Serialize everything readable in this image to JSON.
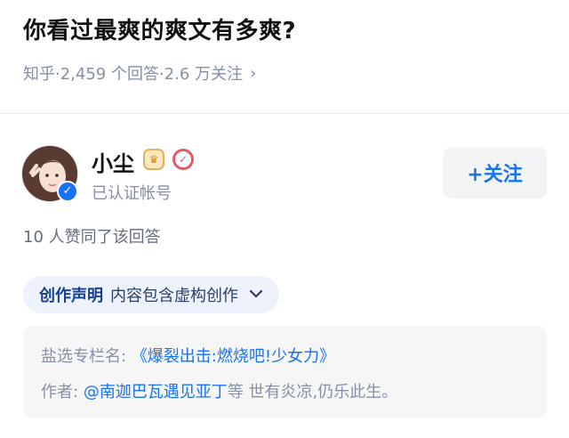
{
  "question": {
    "title": "你看过最爽的爽文有多爽?",
    "meta": "知乎·2,459 个回答·2.6 万关注"
  },
  "author": {
    "name": "小尘",
    "subtitle": "已认证帐号",
    "follow_label": "+关注"
  },
  "answer": {
    "vote_text": "10 人赞同了该回答"
  },
  "declaration": {
    "label": "创作声明",
    "value": "内容包含虚构创作"
  },
  "info": {
    "column_prefix": "盐选专栏名:",
    "column_name": "《爆裂出击:燃烧吧!少女力》",
    "author_prefix": "作者:",
    "author_name": "@南迦巴瓦遇见亚丁",
    "author_suffix": "等 世有炎凉,仍乐此生。"
  },
  "colors": {
    "accent": "#1772f6",
    "meta_gray": "#8590a6",
    "pill_bg": "#eef2fc"
  },
  "icons": {
    "meta_chevron": "chevron-right-icon",
    "verify": "verified-check-icon",
    "crown": "crown-badge-icon",
    "red_check": "red-check-badge-icon",
    "decl_chevron": "chevron-down-icon"
  }
}
